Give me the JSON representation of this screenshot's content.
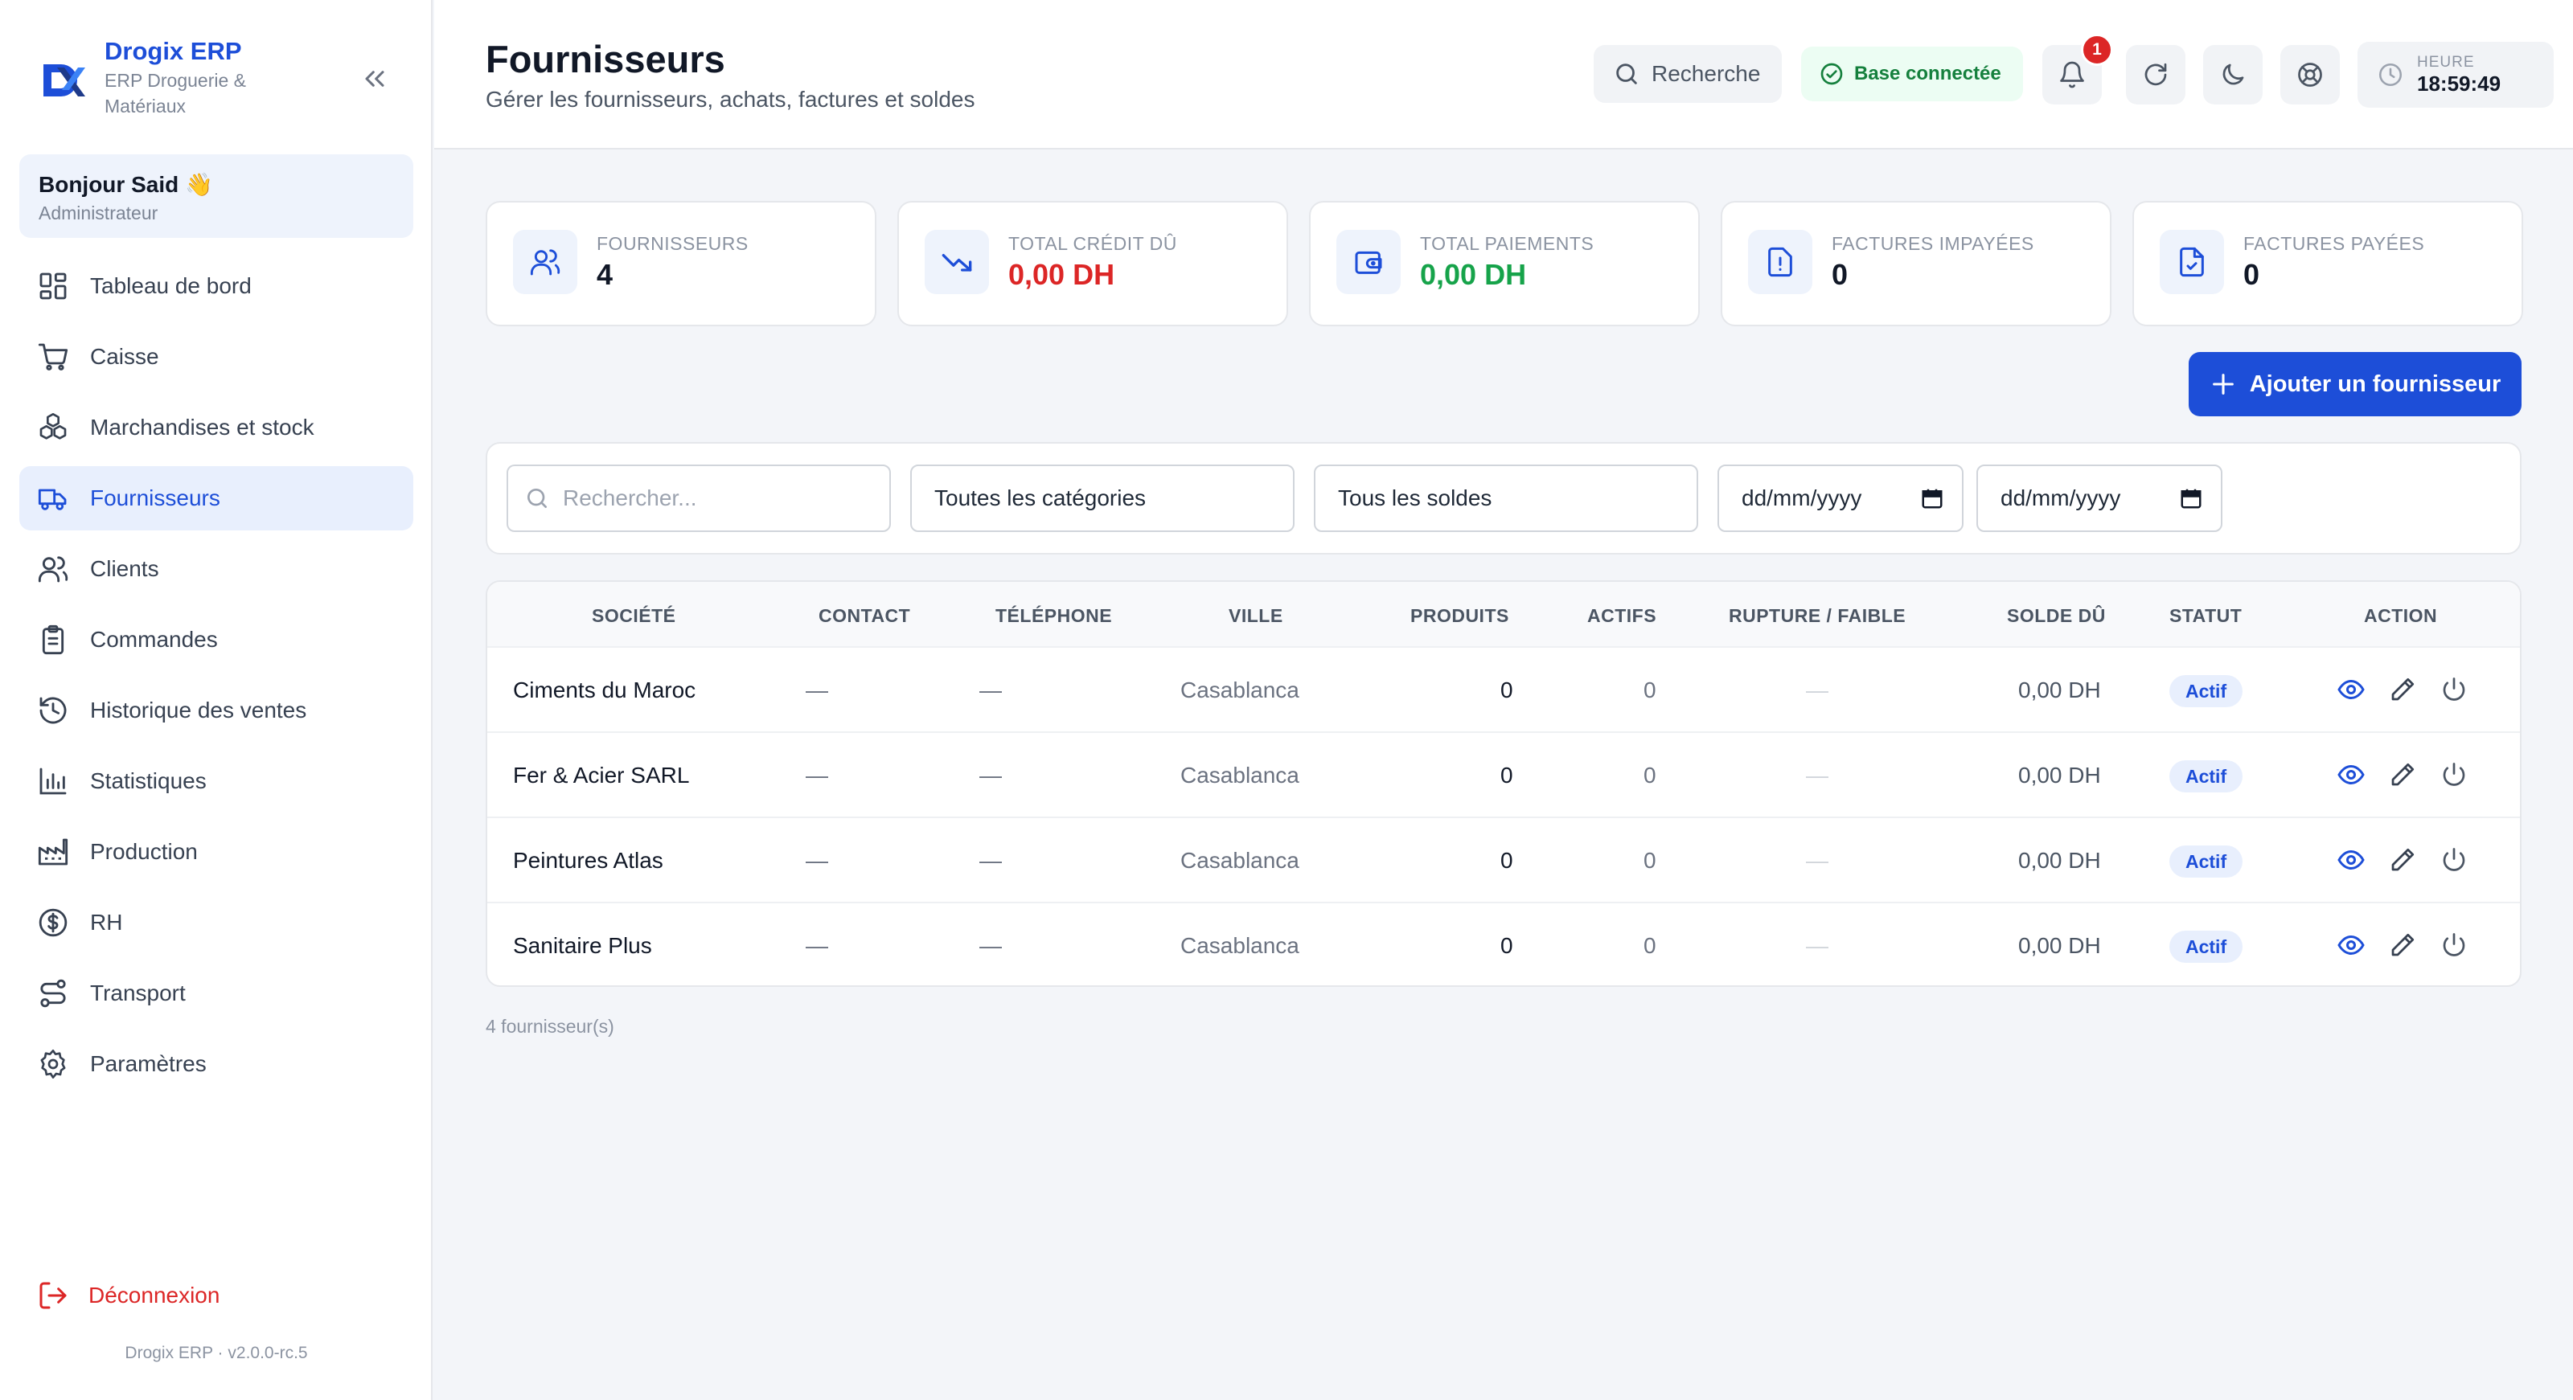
{
  "app": {
    "name": "Drogix ERP",
    "subtitle": "ERP Droguerie & Matériaux",
    "version": "Drogix ERP · v2.0.0-rc.5"
  },
  "user": {
    "greeting": "Bonjour Said 👋",
    "role": "Administrateur"
  },
  "nav": [
    {
      "label": "Tableau de bord",
      "icon": "dashboard-icon"
    },
    {
      "label": "Caisse",
      "icon": "cart-icon"
    },
    {
      "label": "Marchandises et stock",
      "icon": "boxes-icon"
    },
    {
      "label": "Fournisseurs",
      "icon": "truck-icon",
      "active": true
    },
    {
      "label": "Clients",
      "icon": "users-icon"
    },
    {
      "label": "Commandes",
      "icon": "clipboard-icon"
    },
    {
      "label": "Historique des ventes",
      "icon": "history-icon"
    },
    {
      "label": "Statistiques",
      "icon": "bar-chart-icon"
    },
    {
      "label": "Production",
      "icon": "factory-icon"
    },
    {
      "label": "RH",
      "icon": "dollar-icon"
    },
    {
      "label": "Transport",
      "icon": "route-icon"
    },
    {
      "label": "Paramètres",
      "icon": "gear-icon"
    }
  ],
  "logout_label": "Déconnexion",
  "header": {
    "title": "Fournisseurs",
    "subtitle": "Gérer les fournisseurs, achats, factures et soldes",
    "search_label": "Recherche",
    "db_status": "Base connectée",
    "notification_count": "1",
    "time_label": "HEURE",
    "time_value": "18:59:49"
  },
  "stats": [
    {
      "label": "Fournisseurs",
      "value": "4",
      "tone": "dark",
      "icon": "users-icon"
    },
    {
      "label": "Total crédit dû",
      "value": "0,00 DH",
      "tone": "red",
      "icon": "trending-down-icon"
    },
    {
      "label": "Total paiements",
      "value": "0,00 DH",
      "tone": "green",
      "icon": "wallet-icon"
    },
    {
      "label": "Factures impayées",
      "value": "0",
      "tone": "dark",
      "icon": "file-alert-icon"
    },
    {
      "label": "Factures payées",
      "value": "0",
      "tone": "dark",
      "icon": "file-check-icon"
    }
  ],
  "add_button_label": "Ajouter un fournisseur",
  "filters": {
    "search_placeholder": "Rechercher...",
    "category": "Toutes les catégories",
    "balance": "Tous les soldes",
    "date_from": "dd/mm/yyyy",
    "date_to": "dd/mm/yyyy"
  },
  "table": {
    "columns": [
      "Société",
      "Contact",
      "Téléphone",
      "Ville",
      "Produits",
      "Actifs",
      "Rupture / Faible",
      "Solde dû",
      "Statut",
      "Action"
    ],
    "rows": [
      {
        "company": "Ciments du Maroc",
        "contact": "—",
        "phone": "—",
        "city": "Casablanca",
        "products": "0",
        "active": "0",
        "low": "—",
        "balance": "0,00 DH",
        "status": "Actif"
      },
      {
        "company": "Fer & Acier SARL",
        "contact": "—",
        "phone": "—",
        "city": "Casablanca",
        "products": "0",
        "active": "0",
        "low": "—",
        "balance": "0,00 DH",
        "status": "Actif"
      },
      {
        "company": "Peintures Atlas",
        "contact": "—",
        "phone": "—",
        "city": "Casablanca",
        "products": "0",
        "active": "0",
        "low": "—",
        "balance": "0,00 DH",
        "status": "Actif"
      },
      {
        "company": "Sanitaire Plus",
        "contact": "—",
        "phone": "—",
        "city": "Casablanca",
        "products": "0",
        "active": "0",
        "low": "—",
        "balance": "0,00 DH",
        "status": "Actif"
      }
    ]
  },
  "footer_count": "4 fournisseur(s)",
  "colors": {
    "primary": "#1d4ed8",
    "danger": "#dc2626",
    "success": "#16a34a"
  }
}
